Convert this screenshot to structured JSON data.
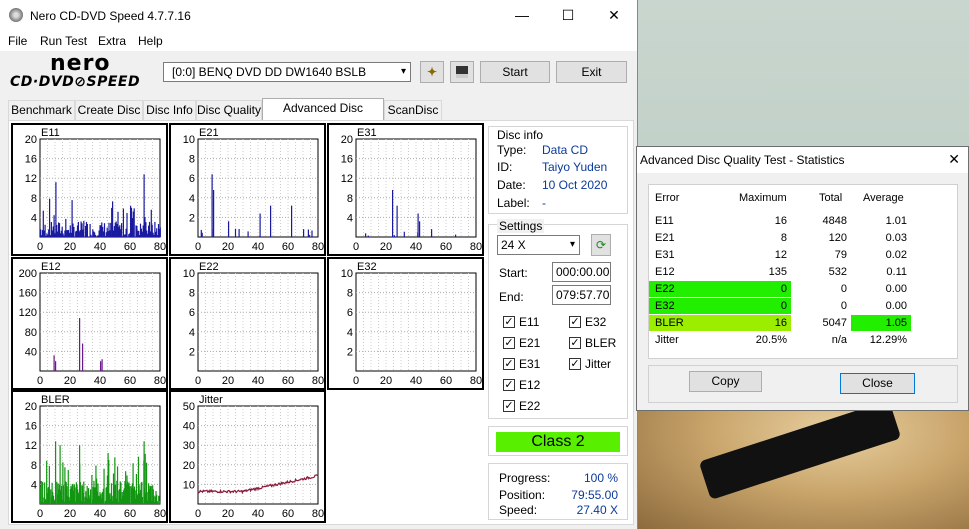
{
  "main_window": {
    "title": "Nero CD-DVD Speed 4.7.7.16",
    "menu": [
      "File",
      "Run Test",
      "Extra",
      "Help"
    ],
    "logo_top": "nero",
    "logo_bottom": "CD·DVD⊘SPEED",
    "drive": "[0:0]   BENQ DVD DD DW1640 BSLB",
    "start_label": "Start",
    "exit_label": "Exit",
    "tabs": [
      "Benchmark",
      "Create Disc",
      "Disc Info",
      "Disc Quality",
      "Advanced Disc Quality",
      "ScanDisc"
    ],
    "active_tab": "Advanced Disc Quality"
  },
  "disc_info": {
    "heading": "Disc info",
    "type_label": "Type:",
    "type": "Data CD",
    "id_label": "ID:",
    "id": "Taiyo Yuden",
    "date_label": "Date:",
    "date": "10 Oct 2020",
    "label_label": "Label:",
    "label": "-"
  },
  "settings": {
    "heading": "Settings",
    "speed": "24 X",
    "start_label": "Start:",
    "start": "000:00.00",
    "end_label": "End:",
    "end": "079:57.70",
    "checks": {
      "e11": "E11",
      "e32": "E32",
      "e21": "E21",
      "bler": "BLER",
      "e31": "E31",
      "jitter": "Jitter",
      "e12": "E12",
      "e22": "E22"
    }
  },
  "class_label": "Class 2",
  "progress": {
    "progress_label": "Progress:",
    "progress": "100 %",
    "position_label": "Position:",
    "position": "79:55.00",
    "speed_label": "Speed:",
    "speed": "27.40 X"
  },
  "charts": {
    "e11": {
      "title": "E11",
      "yticks": [
        "20",
        "16",
        "12",
        "8",
        "4"
      ],
      "xticks": [
        "0",
        "20",
        "40",
        "60",
        "80"
      ]
    },
    "e21": {
      "title": "E21",
      "yticks": [
        "10",
        "8",
        "6",
        "4",
        "2"
      ],
      "xticks": [
        "0",
        "20",
        "40",
        "60",
        "80"
      ]
    },
    "e31": {
      "title": "E31",
      "yticks": [
        "20",
        "16",
        "12",
        "8",
        "4"
      ],
      "xticks": [
        "0",
        "20",
        "40",
        "60",
        "80"
      ]
    },
    "e12": {
      "title": "E12",
      "yticks": [
        "200",
        "160",
        "120",
        "80",
        "40"
      ],
      "xticks": [
        "0",
        "20",
        "40",
        "60",
        "80"
      ]
    },
    "e22": {
      "title": "E22",
      "yticks": [
        "10",
        "8",
        "6",
        "4",
        "2"
      ],
      "xticks": [
        "0",
        "20",
        "40",
        "60",
        "80"
      ]
    },
    "e32": {
      "title": "E32",
      "yticks": [
        "10",
        "8",
        "6",
        "4",
        "2"
      ],
      "xticks": [
        "0",
        "20",
        "40",
        "60",
        "80"
      ]
    },
    "bler": {
      "title": "BLER",
      "yticks": [
        "20",
        "16",
        "12",
        "8",
        "4"
      ],
      "xticks": [
        "0",
        "20",
        "40",
        "60",
        "80"
      ]
    },
    "jitter": {
      "title": "Jitter",
      "yticks": [
        "50",
        "40",
        "30",
        "20",
        "10"
      ],
      "xticks": [
        "0",
        "20",
        "40",
        "60",
        "80"
      ]
    }
  },
  "stats": {
    "title": "Advanced Disc Quality Test - Statistics",
    "headers": [
      "Error",
      "Maximum",
      "Total",
      "Average"
    ],
    "rows": [
      {
        "name": "E11",
        "max": "16",
        "total": "4848",
        "avg": "1.01"
      },
      {
        "name": "E21",
        "max": "8",
        "total": "120",
        "avg": "0.03"
      },
      {
        "name": "E31",
        "max": "12",
        "total": "79",
        "avg": "0.02"
      },
      {
        "name": "E12",
        "max": "135",
        "total": "532",
        "avg": "0.11"
      },
      {
        "name": "E22",
        "max": "0",
        "total": "0",
        "avg": "0.00"
      },
      {
        "name": "E32",
        "max": "0",
        "total": "0",
        "avg": "0.00"
      },
      {
        "name": "BLER",
        "max": "16",
        "total": "5047",
        "avg": "1.05"
      },
      {
        "name": "Jitter",
        "max": "20.5%",
        "total": "n/a",
        "avg": "12.29%"
      }
    ],
    "copy_label": "Copy",
    "close_label": "Close",
    "highlight_green": "#22ee00",
    "highlight_lime": "#9bee00"
  }
}
